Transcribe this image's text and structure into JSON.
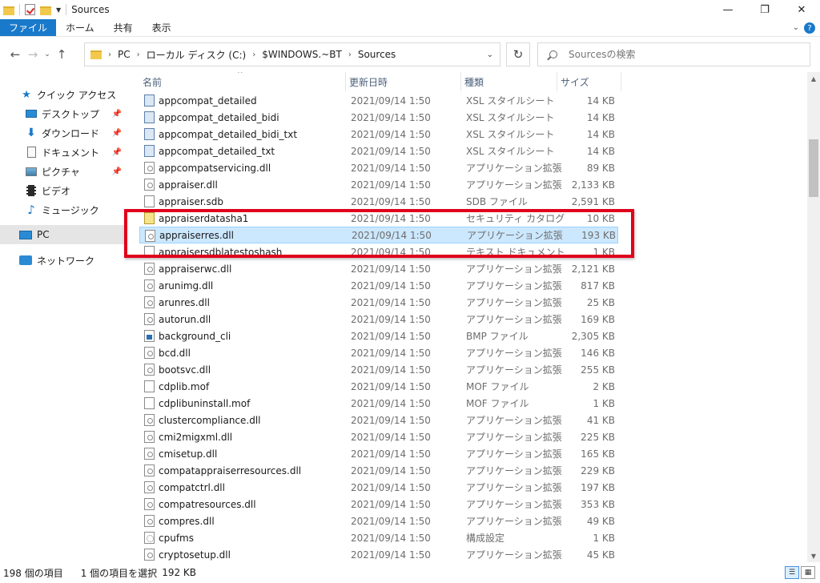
{
  "window": {
    "title": "Sources",
    "minimize": "—",
    "maximize": "❐",
    "close": "✕"
  },
  "ribbon": {
    "tabs": [
      "ファイル",
      "ホーム",
      "共有",
      "表示"
    ],
    "help": "?"
  },
  "address": {
    "crumbs": [
      "PC",
      "ローカル ディスク (C:)",
      "$WINDOWS.~BT",
      "Sources"
    ],
    "search_placeholder": "Sourcesの検索"
  },
  "nav": {
    "items": [
      {
        "label": "クイック アクセス",
        "icon": "star-icon"
      },
      {
        "label": "デスクトップ",
        "icon": "desktop-icon",
        "pinned": true
      },
      {
        "label": "ダウンロード",
        "icon": "download-icon",
        "pinned": true
      },
      {
        "label": "ドキュメント",
        "icon": "document-icon",
        "pinned": true
      },
      {
        "label": "ピクチャ",
        "icon": "picture-icon",
        "pinned": true
      },
      {
        "label": "ビデオ",
        "icon": "video-icon"
      },
      {
        "label": "ミュージック",
        "icon": "music-icon"
      },
      {
        "label": "PC",
        "icon": "pc-icon",
        "selected": true
      },
      {
        "label": "ネットワーク",
        "icon": "network-icon"
      }
    ]
  },
  "columns": {
    "name": "名前",
    "date": "更新日時",
    "type": "種類",
    "size": "サイズ"
  },
  "files": [
    {
      "name": "appcompat_detailed",
      "date": "2021/09/14 1:50",
      "type": "XSL スタイルシート",
      "size": "14 KB",
      "icon": "xsl"
    },
    {
      "name": "appcompat_detailed_bidi",
      "date": "2021/09/14 1:50",
      "type": "XSL スタイルシート",
      "size": "14 KB",
      "icon": "xsl"
    },
    {
      "name": "appcompat_detailed_bidi_txt",
      "date": "2021/09/14 1:50",
      "type": "XSL スタイルシート",
      "size": "14 KB",
      "icon": "xsl"
    },
    {
      "name": "appcompat_detailed_txt",
      "date": "2021/09/14 1:50",
      "type": "XSL スタイルシート",
      "size": "14 KB",
      "icon": "xsl"
    },
    {
      "name": "appcompatservicing.dll",
      "date": "2021/09/14 1:50",
      "type": "アプリケーション拡張",
      "size": "89 KB",
      "icon": "dll"
    },
    {
      "name": "appraiser.dll",
      "date": "2021/09/14 1:50",
      "type": "アプリケーション拡張",
      "size": "2,133 KB",
      "icon": "dll"
    },
    {
      "name": "appraiser.sdb",
      "date": "2021/09/14 1:50",
      "type": "SDB ファイル",
      "size": "2,591 KB",
      "icon": "file"
    },
    {
      "name": "appraiserdatasha1",
      "date": "2021/09/14 1:50",
      "type": "セキュリティ カタログ",
      "size": "10 KB",
      "icon": "cat"
    },
    {
      "name": "appraiserres.dll",
      "date": "2021/09/14 1:50",
      "type": "アプリケーション拡張",
      "size": "193 KB",
      "icon": "dll",
      "selected": true
    },
    {
      "name": "appraisersdblatestoshash",
      "date": "2021/09/14 1:50",
      "type": "テキスト ドキュメント",
      "size": "1 KB",
      "icon": "file"
    },
    {
      "name": "appraiserwc.dll",
      "date": "2021/09/14 1:50",
      "type": "アプリケーション拡張",
      "size": "2,121 KB",
      "icon": "dll"
    },
    {
      "name": "arunimg.dll",
      "date": "2021/09/14 1:50",
      "type": "アプリケーション拡張",
      "size": "817 KB",
      "icon": "dll"
    },
    {
      "name": "arunres.dll",
      "date": "2021/09/14 1:50",
      "type": "アプリケーション拡張",
      "size": "25 KB",
      "icon": "dll"
    },
    {
      "name": "autorun.dll",
      "date": "2021/09/14 1:50",
      "type": "アプリケーション拡張",
      "size": "169 KB",
      "icon": "dll"
    },
    {
      "name": "background_cli",
      "date": "2021/09/14 1:50",
      "type": "BMP ファイル",
      "size": "2,305 KB",
      "icon": "bmp"
    },
    {
      "name": "bcd.dll",
      "date": "2021/09/14 1:50",
      "type": "アプリケーション拡張",
      "size": "146 KB",
      "icon": "dll"
    },
    {
      "name": "bootsvc.dll",
      "date": "2021/09/14 1:50",
      "type": "アプリケーション拡張",
      "size": "255 KB",
      "icon": "dll"
    },
    {
      "name": "cdplib.mof",
      "date": "2021/09/14 1:50",
      "type": "MOF ファイル",
      "size": "2 KB",
      "icon": "file"
    },
    {
      "name": "cdplibuninstall.mof",
      "date": "2021/09/14 1:50",
      "type": "MOF ファイル",
      "size": "1 KB",
      "icon": "file"
    },
    {
      "name": "clustercompliance.dll",
      "date": "2021/09/14 1:50",
      "type": "アプリケーション拡張",
      "size": "41 KB",
      "icon": "dll"
    },
    {
      "name": "cmi2migxml.dll",
      "date": "2021/09/14 1:50",
      "type": "アプリケーション拡張",
      "size": "225 KB",
      "icon": "dll"
    },
    {
      "name": "cmisetup.dll",
      "date": "2021/09/14 1:50",
      "type": "アプリケーション拡張",
      "size": "165 KB",
      "icon": "dll"
    },
    {
      "name": "compatappraiserresources.dll",
      "date": "2021/09/14 1:50",
      "type": "アプリケーション拡張",
      "size": "229 KB",
      "icon": "dll"
    },
    {
      "name": "compatctrl.dll",
      "date": "2021/09/14 1:50",
      "type": "アプリケーション拡張",
      "size": "197 KB",
      "icon": "dll"
    },
    {
      "name": "compatresources.dll",
      "date": "2021/09/14 1:50",
      "type": "アプリケーション拡張",
      "size": "353 KB",
      "icon": "dll"
    },
    {
      "name": "compres.dll",
      "date": "2021/09/14 1:50",
      "type": "アプリケーション拡張",
      "size": "49 KB",
      "icon": "dll"
    },
    {
      "name": "cpufms",
      "date": "2021/09/14 1:50",
      "type": "構成設定",
      "size": "1 KB",
      "icon": "cfg"
    },
    {
      "name": "cryptosetup.dll",
      "date": "2021/09/14 1:50",
      "type": "アプリケーション拡張",
      "size": "45 KB",
      "icon": "dll"
    }
  ],
  "status": {
    "count": "198 個の項目",
    "selected": "1 個の項目を選択",
    "selected_size": "192 KB"
  }
}
